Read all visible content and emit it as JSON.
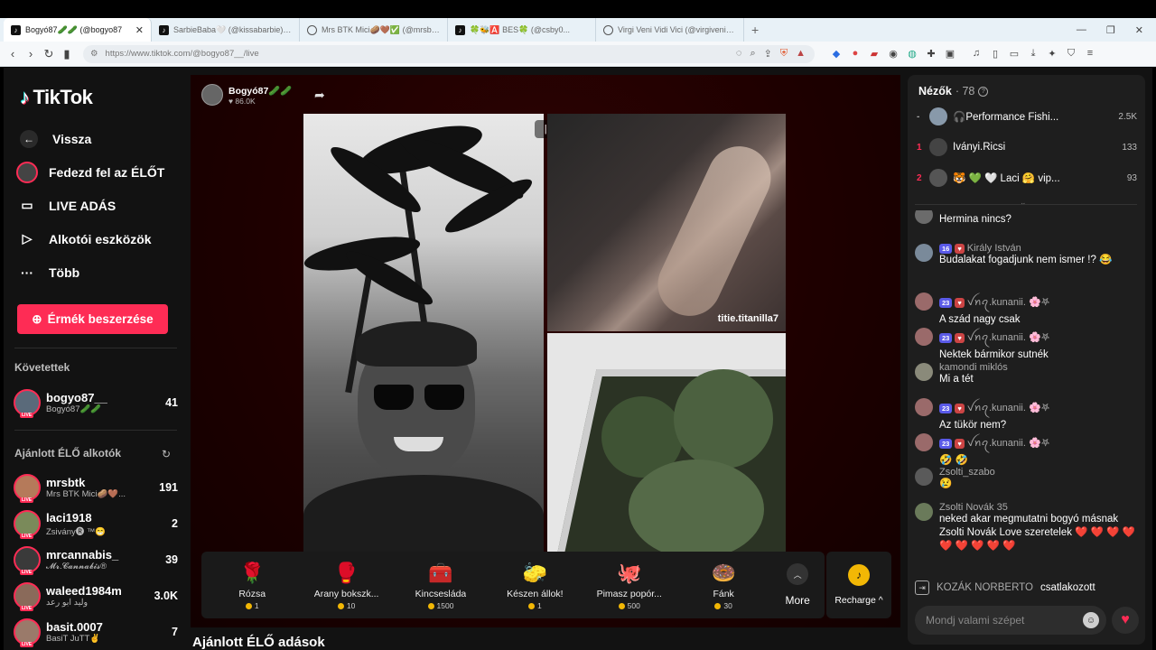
{
  "browser": {
    "tabs": [
      {
        "label": "Bogyó87🥒🥒 (@bogyo87",
        "active": true
      },
      {
        "label": "SarbieBaba🤍 (@kissabarbie) ÉLŐ a...",
        "active": false
      },
      {
        "label": "Mrs BTK Mici🥔🤎✅ (@mrsbtk) É...",
        "active": false
      },
      {
        "label": "🍀🐝🅰️ BES🍀 (@csby0...",
        "active": false
      },
      {
        "label": "Virgi Veni Vidi Vici (@virgiveniviidivic",
        "active": false
      }
    ],
    "url": "https://www.tiktok.com/@bogyo87__/live"
  },
  "sidebar": {
    "logo": "TikTok",
    "nav": [
      {
        "label": "Vissza"
      },
      {
        "label": "Fedezd fel az ÉLŐT"
      },
      {
        "label": "LIVE ADÁS"
      },
      {
        "label": "Alkotói eszközök"
      },
      {
        "label": "Több"
      }
    ],
    "coin_button": "Érmék beszerzése",
    "following_title": "Követettek",
    "following": [
      {
        "name": "bogyo87__",
        "sub": "Bogyó87🥒🥒",
        "count": "41"
      }
    ],
    "recommended_title": "Ajánlott ÉLŐ alkotók",
    "recommended": [
      {
        "name": "mrsbtk",
        "sub": "Mrs BTK Mici🥔🤎...",
        "count": "191"
      },
      {
        "name": "laci1918",
        "sub": "Zsivány🅡 ™😁",
        "count": "2"
      },
      {
        "name": "mrcannabis_",
        "sub": "𝓜𝓻.𝓒𝓪𝓷𝓷𝓪𝓫𝓲𝓼®",
        "count": "39"
      },
      {
        "name": "waleed1984m",
        "sub": "وليد ابو رعد",
        "count": "3.0K"
      },
      {
        "name": "basit.0007",
        "sub": "BasiT JuTT✌",
        "count": "7"
      }
    ],
    "live_badge": "LIVE"
  },
  "stream": {
    "host_name": "Bogyó87🥒🥒",
    "host_likes": "♥ 86.0K",
    "guest_name": "titie.titanilla7"
  },
  "gifts": [
    {
      "name": "Rózsa",
      "price": "1",
      "icon": "🌹"
    },
    {
      "name": "Arany bokszk...",
      "price": "10",
      "icon": "🥊"
    },
    {
      "name": "Kincsesláda",
      "price": "1500",
      "icon": "🧰"
    },
    {
      "name": "Készen állok!",
      "price": "1",
      "icon": "🧽"
    },
    {
      "name": "Pimasz popór...",
      "price": "500",
      "icon": "🐙"
    },
    {
      "name": "Fánk",
      "price": "30",
      "icon": "🍩"
    }
  ],
  "more_label": "More",
  "recharge_label": "Recharge ^",
  "suggest_title": "Ajánlott ÉLŐ adások",
  "viewers": {
    "title": "Nézők",
    "count": "· 78",
    "list": [
      {
        "rank": "-",
        "name": "🎧Performance Fishi...",
        "score": "2.5K"
      },
      {
        "rank": "1",
        "name": "Iványi.Ricsi",
        "score": "133"
      },
      {
        "rank": "2",
        "name": "🐯 💚 🤍 Laci 🤗 vip...",
        "score": "93"
      }
    ]
  },
  "chat": [
    {
      "name": "",
      "level": "",
      "text": "Hermina nincs?"
    },
    {
      "name": "Király István",
      "level": "16",
      "text": "Budalakat fogadjunk nem ismer !? 😂"
    },
    {
      "name": "ꪜꪀꪖ.kunanii. 🌸𖤐",
      "level": "23",
      "text": "A szád nagy csak"
    },
    {
      "name": "ꪜꪀꪖ.kunanii. 🌸𖤐",
      "level": "23",
      "text": "Nektek bármikor sutnék"
    },
    {
      "name": "kamondi miklós",
      "level": "",
      "text": "Mi a tét"
    },
    {
      "name": "ꪜꪀꪖ.kunanii. 🌸𖤐",
      "level": "23",
      "text": "Az tükör nem?"
    },
    {
      "name": "ꪜꪀꪖ.kunanii. 🌸𖤐",
      "level": "23",
      "text": "🤣 🤣"
    },
    {
      "name": "Zsolti_szabo",
      "level": "",
      "text": "😢"
    },
    {
      "name": "Zsolti Novák 35",
      "level": "",
      "text": "neked akar megmutatni bogyó másnak Zsolti Novák Love szeretelek ❤️ ❤️ ❤️ ❤️ ❤️ ❤️ ❤️ ❤️ ❤️"
    }
  ],
  "join": {
    "name": "KOZÁK NORBERTO",
    "text": "csatlakozott"
  },
  "chat_input": {
    "placeholder": "Mondj valami szépet"
  },
  "colors": {
    "brand": "#fe2c55",
    "coin": "#f2b705",
    "level_badge": "#5a5ae8"
  }
}
